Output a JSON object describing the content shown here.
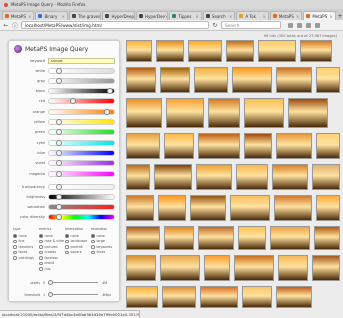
{
  "window_title": "MetaPS Image Query - Mozilla Firefox",
  "tabs": [
    {
      "label": "MetaPS",
      "color": "#e86a1a"
    },
    {
      "label": "Binary",
      "color": "#3a6fd8"
    },
    {
      "label": "The gravest",
      "color": "#444444"
    },
    {
      "label": "HyperDeep",
      "color": "#444444"
    },
    {
      "label": "HyperDee",
      "color": "#444444"
    },
    {
      "label": "Tippes",
      "color": "#2e8b57"
    },
    {
      "label": "Search",
      "color": "#444444"
    },
    {
      "label": "A Tok",
      "color": "#e0a020"
    },
    {
      "label": "MetaPS",
      "color": "#e86a1a"
    },
    {
      "label": "MetaPS",
      "color": "#e86a1a",
      "active": true
    }
  ],
  "url": "localhost/MetaPS/www/dist/img.html",
  "search_placeholder": "Search",
  "results_info": "96 hits (350 total; out of 27,987 images)",
  "panel": {
    "title": "MetaPS Image Query",
    "keyword_label": "keyword",
    "keyword_value": "sunset",
    "colors": [
      {
        "label": "white",
        "gradient": "linear-gradient(90deg,#ffffff,#dddddd)",
        "pos": 0.12
      },
      {
        "label": "gray",
        "gradient": "linear-gradient(90deg,#ffffff,#999999)",
        "pos": 0.12
      },
      {
        "label": "black",
        "gradient": "linear-gradient(90deg,#ffffff,#000000)",
        "pos": 0.95
      },
      {
        "label": "red",
        "gradient": "linear-gradient(90deg,#ffffff,#ff0000)",
        "pos": 0.35
      },
      {
        "label": "orange",
        "gradient": "linear-gradient(90deg,#ffffff,#ff8000)",
        "pos": 0.9
      },
      {
        "label": "yellow",
        "gradient": "linear-gradient(90deg,#ffffff,#ffe600)",
        "pos": 0.12
      },
      {
        "label": "green",
        "gradient": "linear-gradient(90deg,#ffffff,#22dd22)",
        "pos": 0.12
      },
      {
        "label": "cyan",
        "gradient": "linear-gradient(90deg,#ffffff,#00e6e6)",
        "pos": 0.12
      },
      {
        "label": "blue",
        "gradient": "linear-gradient(90deg,#ffffff,#0000ff)",
        "pos": 0.12
      },
      {
        "label": "violet",
        "gradient": "linear-gradient(90deg,#ffffff,#9a2be2)",
        "pos": 0.12
      },
      {
        "label": "magenta",
        "gradient": "linear-gradient(90deg,#ffffff,#ff00ff)",
        "pos": 0.12
      }
    ],
    "tones": [
      {
        "label": "transparency",
        "gradient": "linear-gradient(90deg,#ffffff,#eeeeee)",
        "pos": 0.12
      },
      {
        "label": "brightness",
        "gradient": "linear-gradient(90deg,#000000,#ffffff)",
        "pos": 0.12
      },
      {
        "label": "saturation",
        "gradient": "linear-gradient(90deg,#888888,#ff2020)",
        "pos": 0.12
      },
      {
        "label": "color diversity",
        "gradient": "linear-gradient(90deg,#ff0000,#ffff00,#00ff00,#00ffff,#0000ff,#ff00ff)",
        "pos": 0.12
      }
    ],
    "options": [
      {
        "head": "type",
        "items": [
          {
            "label": "none",
            "on": true
          },
          {
            "label": "line"
          },
          {
            "label": "travelers"
          },
          {
            "label": "faces"
          },
          {
            "label": "paintings"
          }
        ]
      },
      {
        "head": "metrics",
        "items": [
          {
            "label": "none",
            "on": true
          },
          {
            "label": "rose & slide"
          },
          {
            "label": "pictures"
          },
          {
            "label": "crowds"
          },
          {
            "label": "faceless"
          },
          {
            "label": "brand"
          },
          {
            "label": "mix"
          }
        ]
      },
      {
        "head": "orientation",
        "items": [
          {
            "label": "none",
            "on": true
          },
          {
            "label": "landscape"
          },
          {
            "label": "portrait"
          },
          {
            "label": "square"
          }
        ]
      },
      {
        "head": "resolution",
        "items": [
          {
            "label": "none",
            "on": true
          },
          {
            "label": "large"
          },
          {
            "label": "keywords"
          },
          {
            "label": "faces"
          }
        ]
      }
    ],
    "pixels_label": "pixels",
    "pixels_min": "5",
    "pixels_max": "4M",
    "threshold_label": "threshold",
    "threshold_min": "1",
    "threshold_max": "4Mpx"
  },
  "thumbnails": [
    {
      "tone": "#ffb030"
    },
    {
      "tone": "#e88a10"
    },
    {
      "tone": "#f7a820"
    },
    {
      "tone": "#c86a10"
    },
    {
      "tone": "#ffcc60"
    },
    {
      "tone": "#d87818"
    },
    {
      "tone": "#b05a10"
    },
    {
      "tone": "#a0600a"
    },
    {
      "tone": "#f0b040"
    },
    {
      "tone": "#ff9a20"
    },
    {
      "tone": "#c87020"
    },
    {
      "tone": "#ffd070"
    },
    {
      "tone": "#e89028"
    },
    {
      "tone": "#fca030"
    },
    {
      "tone": "#d07a20"
    },
    {
      "tone": "#f8c050"
    },
    {
      "tone": "#9a4a10"
    },
    {
      "tone": "#e8a040"
    },
    {
      "tone": "#ffb848"
    },
    {
      "tone": "#c06010"
    },
    {
      "tone": "#a04808"
    },
    {
      "tone": "#e89838"
    },
    {
      "tone": "#ffd080"
    },
    {
      "tone": "#b86a18"
    },
    {
      "tone": "#804008"
    },
    {
      "tone": "#f0a030"
    },
    {
      "tone": "#fcb850"
    },
    {
      "tone": "#d88020"
    },
    {
      "tone": "#e0b070"
    },
    {
      "tone": "#c87828"
    },
    {
      "tone": "#ff9820"
    },
    {
      "tone": "#905010"
    },
    {
      "tone": "#f8c060"
    },
    {
      "tone": "#d0782c"
    },
    {
      "tone": "#ffac38"
    },
    {
      "tone": "#a85a18"
    },
    {
      "tone": "#e08820"
    },
    {
      "tone": "#c06828"
    },
    {
      "tone": "#ffc458"
    },
    {
      "tone": "#f0a448"
    },
    {
      "tone": "#b05810"
    },
    {
      "tone": "#d89030"
    },
    {
      "tone": "#e8a850"
    },
    {
      "tone": "#ff9c30"
    },
    {
      "tone": "#c87018"
    },
    {
      "tone": "#f4b858"
    },
    {
      "tone": "#a05820"
    },
    {
      "tone": "#ffb030"
    },
    {
      "tone": "#e09030"
    },
    {
      "tone": "#d87020"
    },
    {
      "tone": "#f8c868"
    },
    {
      "tone": "#c06018"
    },
    {
      "tone": "#ffa828"
    },
    {
      "tone": "#b87020"
    },
    {
      "tone": "#e8982c"
    }
  ],
  "status_url": "localhost:21000/meta/files/3/5f7d4bc4b0fab3b3d19e799e0021e0-3517fe3d-d1900a"
}
